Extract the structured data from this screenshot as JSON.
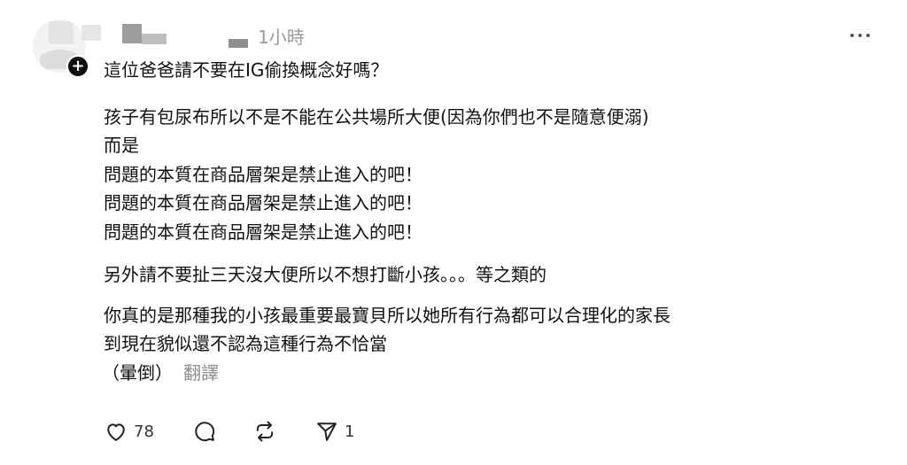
{
  "post": {
    "timestamp": "1小時",
    "lines": [
      "這位爸爸請不要在IG偷換概念好嗎？",
      "孩子有包尿布所以不是不能在公共場所大便(因為你們也不是隨意便溺)",
      "而是",
      "問題的本質在商品層架是禁止進入的吧！",
      "問題的本質在商品層架是禁止進入的吧！",
      "問題的本質在商品層架是禁止進入的吧！",
      "另外請不要扯三天沒大便所以不想打斷小孩。。。等之類的",
      "你真的是那種我的小孩最重要最寶貝所以她所有行為都可以合理化的家長",
      "到現在貌似還不認為這種行為不恰當"
    ],
    "closing_text": "（暈倒）",
    "translate_label": "翻譯"
  },
  "actions": {
    "like_count": "78",
    "repost_count": "",
    "share_count": "1",
    "icons": {
      "like": "heart-icon",
      "reply": "comment-icon",
      "repost": "repost-icon",
      "share": "send-icon"
    }
  },
  "header": {
    "follow_badge": "+",
    "more_icon": "more-horizontal-icon"
  }
}
